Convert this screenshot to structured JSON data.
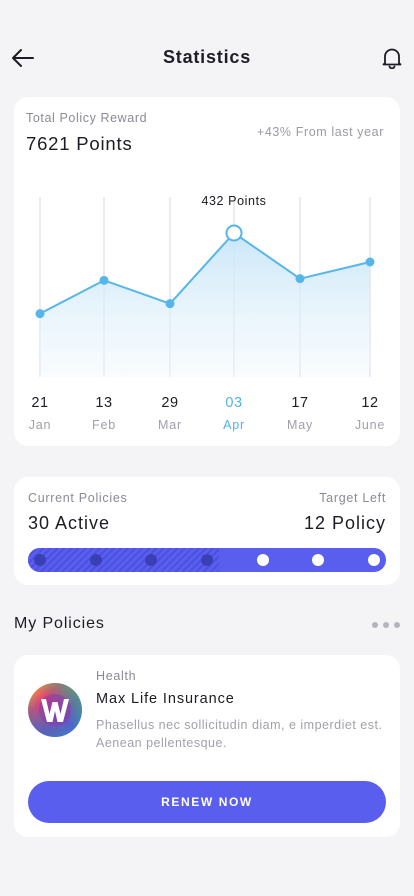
{
  "header": {
    "title": "Statistics",
    "back_icon": "arrow-left-icon",
    "bell_icon": "bell-icon"
  },
  "reward": {
    "label": "Total Policy Reward",
    "value": "7621 Points",
    "change": "+43% From last year",
    "highlight_label": "432 Points"
  },
  "chart_data": {
    "type": "area",
    "title": "",
    "xlabel": "",
    "ylabel": "",
    "categories": [
      "Jan",
      "Feb",
      "Mar",
      "Apr",
      "May",
      "June"
    ],
    "days": [
      "21",
      "13",
      "29",
      "03",
      "17",
      "12"
    ],
    "values": [
      190,
      290,
      220,
      432,
      295,
      345
    ],
    "ylim": [
      0,
      540
    ],
    "highlight_index": 3,
    "grid": true,
    "line_color": "#56b6ea",
    "fill_color": "#cde8f8",
    "active_color": "#4fb5e6"
  },
  "policies": {
    "current_label": "Current Policies",
    "current_value": "30 Active",
    "target_label": "Target Left",
    "target_value": "12 Policy",
    "steps_total": 7,
    "steps_done": 4,
    "accent": "#5a5eee"
  },
  "my_policies": {
    "title": "My Policies",
    "more_icon": "more-horizontal-icon"
  },
  "insurance": {
    "category": "Health",
    "name": "Max Life Insurance",
    "description": "Phasellus nec sollicitudin diam, e imperdiet est. Aenean pellentesque.",
    "logo_letter": "W",
    "button_label": "RENEW NOW"
  }
}
